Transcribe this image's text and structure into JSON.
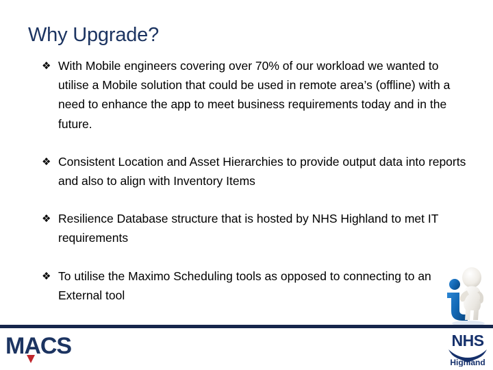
{
  "slide": {
    "title": "Why Upgrade?",
    "title_color": "#1C3461",
    "background_color": "#FFFFFF",
    "bullet_glyph": "❖",
    "bullets": [
      {
        "text": "With Mobile engineers covering over 70% of our workload we wanted to utilise a Mobile solution that could be used in remote area’s (offline) with a need to enhance the app to meet business requirements today and in the future."
      },
      {
        "text": "Consistent Location and Asset Hierarchies to provide output data into reports and also to align with Inventory Items"
      },
      {
        "text": "Resilience Database structure that is hosted by NHS Highland to met IT requirements"
      },
      {
        "text": "To utilise the Maximo Scheduling tools as opposed to connecting to an External tool"
      }
    ]
  },
  "footer": {
    "divider_color": "#16264B",
    "macs_logo": {
      "name": "macs-logo",
      "text": "MACS",
      "color": "#1C3461",
      "accent_color": "#C0272D"
    },
    "nhs_logo": {
      "name": "nhs-highland-logo",
      "primary_text": "NHS",
      "secondary_text": "Highland",
      "color": "#15306B"
    }
  },
  "graphics": {
    "info_figure": {
      "name": "info-person-icon",
      "letter": "i",
      "accent_color": "#1369B6",
      "figure_color": "#F2F0EC"
    }
  }
}
